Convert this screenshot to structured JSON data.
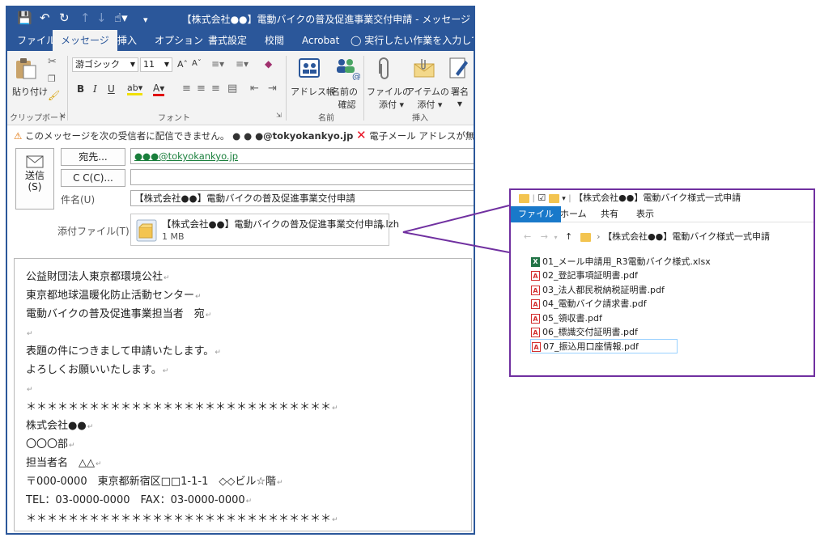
{
  "outlook": {
    "title": "【株式会社●●】電動バイクの普及促進事業交付申請 - メッセージ",
    "tabs": [
      "ファイル",
      "メッセージ",
      "挿入",
      "オプション",
      "書式設定",
      "校閲",
      "Acrobat"
    ],
    "tell_me": "実行したい作業を入力してくだ",
    "ribbon": {
      "paste": "貼り付け",
      "clipboard_group": "クリップボード",
      "font_name": "游ゴシック",
      "font_size": "11",
      "font_group": "フォント",
      "address_book": "アドレス帳",
      "check_names": [
        "名前の",
        "確認"
      ],
      "names_group": "名前",
      "attach_file": [
        "ファイルの",
        "添付 ▾"
      ],
      "attach_item": [
        "アイテムの",
        "添付 ▾"
      ],
      "signature": "署名",
      "insert_group": "挿入"
    },
    "info_bar": {
      "prefix": "このメッセージを次の受信者に配信できません。",
      "address": "● ● ●@tokyokankyo.jp",
      "suffix": "電子メール アドレスが無効になっています。"
    },
    "send": [
      "送信",
      "(S)"
    ],
    "to_button": "宛先...",
    "to_value": "●●●@tokyokankyo.jp",
    "cc_button": "C C(C)...",
    "cc_value": "",
    "subject_label": "件名(U)",
    "subject_value": "【株式会社●●】電動バイクの普及促進事業交付申請",
    "attach_label": "添付ファイル(T)",
    "attachment": {
      "name": "【株式会社●●】電動バイクの普及促進事業交付申請.lzh",
      "size": "1 MB"
    },
    "body_lines": [
      "公益財団法人東京都環境公社",
      "東京都地球温暖化防止活動センター",
      "電動バイクの普及促進事業担当者　宛",
      "",
      "表題の件につきまして申請いたします。",
      "よろしくお願いいたします。",
      "",
      "＊＊＊＊＊＊＊＊＊＊＊＊＊＊＊＊＊＊＊＊＊＊＊＊＊＊＊＊＊",
      "株式会社●●",
      "〇〇〇部",
      "担当者名　△△",
      "〒000-0000　東京都新宿区□□1-1-1　◇◇ビル☆階",
      "TEL：03-0000-0000　FAX：03-0000-0000",
      "＊＊＊＊＊＊＊＊＊＊＊＊＊＊＊＊＊＊＊＊＊＊＊＊＊＊＊＊＊"
    ]
  },
  "explorer": {
    "title": "【株式会社●●】電動バイク様式一式申請",
    "tabs": [
      "ファイル",
      "ホーム",
      "共有",
      "表示"
    ],
    "path": "【株式会社●●】電動バイク様式一式申請",
    "files": [
      {
        "name": "01_メール申請用_R3電動バイク様式.xlsx",
        "type": "xlsx"
      },
      {
        "name": "02_登記事項証明書.pdf",
        "type": "pdf"
      },
      {
        "name": "03_法人都民税納税証明書.pdf",
        "type": "pdf"
      },
      {
        "name": "04_電動バイク請求書.pdf",
        "type": "pdf"
      },
      {
        "name": "05_領収書.pdf",
        "type": "pdf"
      },
      {
        "name": "06_標識交付証明書.pdf",
        "type": "pdf"
      },
      {
        "name": "07_振込用口座情報.pdf",
        "type": "pdf"
      }
    ]
  },
  "colors": {
    "outlook_blue": "#2b579a",
    "callout_purple": "#7030a0",
    "explorer_tab": "#1979ca"
  }
}
